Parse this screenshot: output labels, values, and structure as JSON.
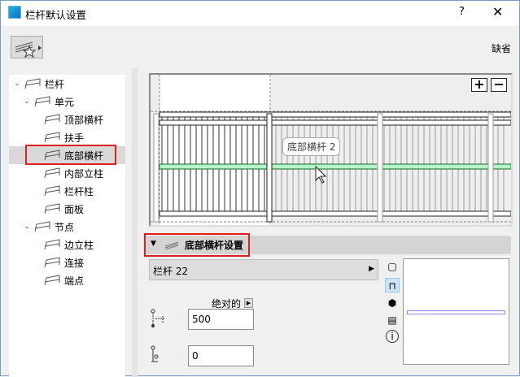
{
  "window": {
    "title": "栏杆默认设置",
    "help": "?",
    "close": "✕"
  },
  "toolbar": {
    "default_label": "缺省"
  },
  "tree": [
    {
      "label": "栏杆",
      "level": 0,
      "chev": true
    },
    {
      "label": "单元",
      "level": 1,
      "chev": true
    },
    {
      "label": "顶部横杆",
      "level": 2
    },
    {
      "label": "扶手",
      "level": 2
    },
    {
      "label": "底部横杆",
      "level": 2,
      "selected": true
    },
    {
      "label": "内部立柱",
      "level": 2
    },
    {
      "label": "栏杆柱",
      "level": 2
    },
    {
      "label": "面板",
      "level": 2
    },
    {
      "label": "节点",
      "level": 1,
      "chev": true
    },
    {
      "label": "边立柱",
      "level": 2
    },
    {
      "label": "连接",
      "level": 2
    },
    {
      "label": "端点",
      "level": 2
    }
  ],
  "preview": {
    "zoom_in": "+",
    "zoom_out": "−",
    "tooltip": "底部横杆 2",
    "highlight_color": "#b3f5c8"
  },
  "section": {
    "title": "底部横杆设置"
  },
  "profile": {
    "value": "栏杆 22"
  },
  "height": {
    "mode_label": "绝对的",
    "value": "500",
    "offset_value": "0"
  },
  "side_icons": {
    "info": "i"
  }
}
